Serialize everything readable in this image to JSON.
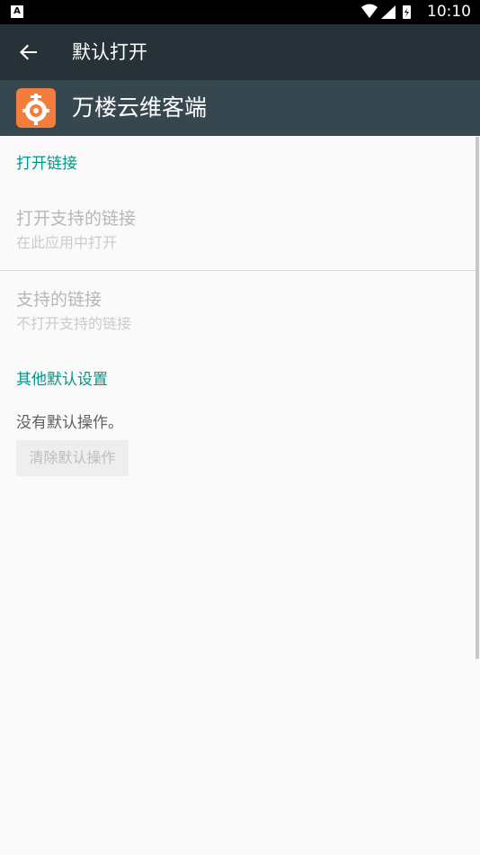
{
  "status_bar": {
    "notification_icon": "A",
    "time": "10:10"
  },
  "toolbar": {
    "title": "默认打开",
    "back_icon": "arrow-back-icon"
  },
  "app": {
    "name": "万楼云维客端",
    "icon_color": "#f47c3c"
  },
  "sections": {
    "open_links": {
      "header": "打开链接",
      "open_supported": {
        "title": "打开支持的链接",
        "subtitle": "在此应用中打开"
      },
      "supported_links": {
        "title": "支持的链接",
        "subtitle": "不打开支持的链接"
      }
    },
    "other_defaults": {
      "header": "其他默认设置",
      "status": "没有默认操作。",
      "clear_button": "清除默认操作"
    }
  },
  "colors": {
    "toolbar": "#263238",
    "app_header": "#37474f",
    "accent": "#009688"
  }
}
